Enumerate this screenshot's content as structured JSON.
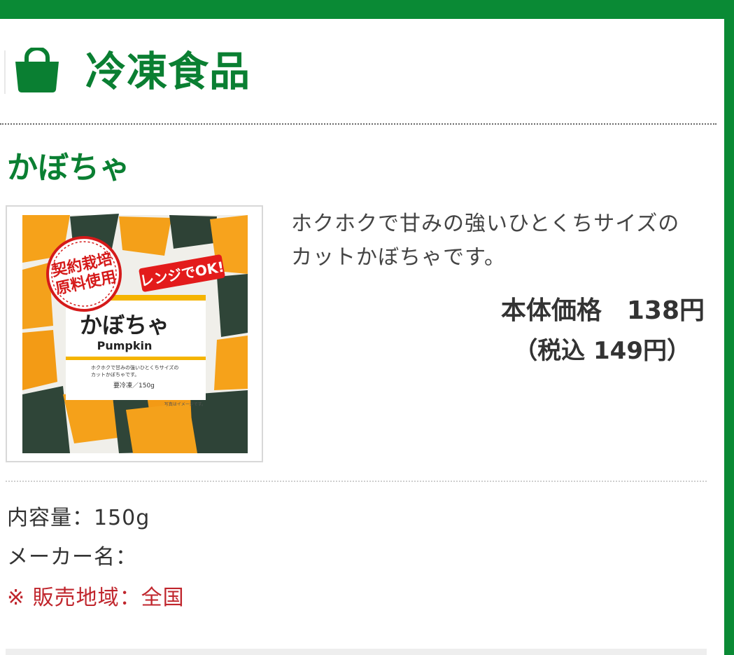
{
  "header": {
    "category_title": "冷凍食品",
    "icon": "shopping-bag-icon"
  },
  "product": {
    "name": "かぼちゃ",
    "description_line1": "ホクホクで甘みの強いひとくちサイズの",
    "description_line2": "カットかぼちゃです。",
    "price_label_main": "本体価格　138円",
    "price_label_tax": "（税込 149円）",
    "package": {
      "badge_contract": "契約栽培原料使用",
      "badge_contract_line1": "契約栽培",
      "badge_contract_line2": "原料使用",
      "badge_range": "レンジでOK!",
      "name_ja": "かぼちゃ",
      "name_en": "Pumpkin",
      "tagline_line1": "ホクホクで甘みの強いひとくちサイズの",
      "tagline_line2": "カットかぼちゃです。",
      "weight": "要冷凍／150g",
      "note": "写真はイメージです。"
    }
  },
  "specs": {
    "content": "内容量：150g",
    "maker": "メーカー名：",
    "area": "※ 販売地域：全国"
  },
  "colors": {
    "brand_green": "#0a8a35",
    "title_green": "#0a7f32",
    "area_red": "#c0262d"
  }
}
